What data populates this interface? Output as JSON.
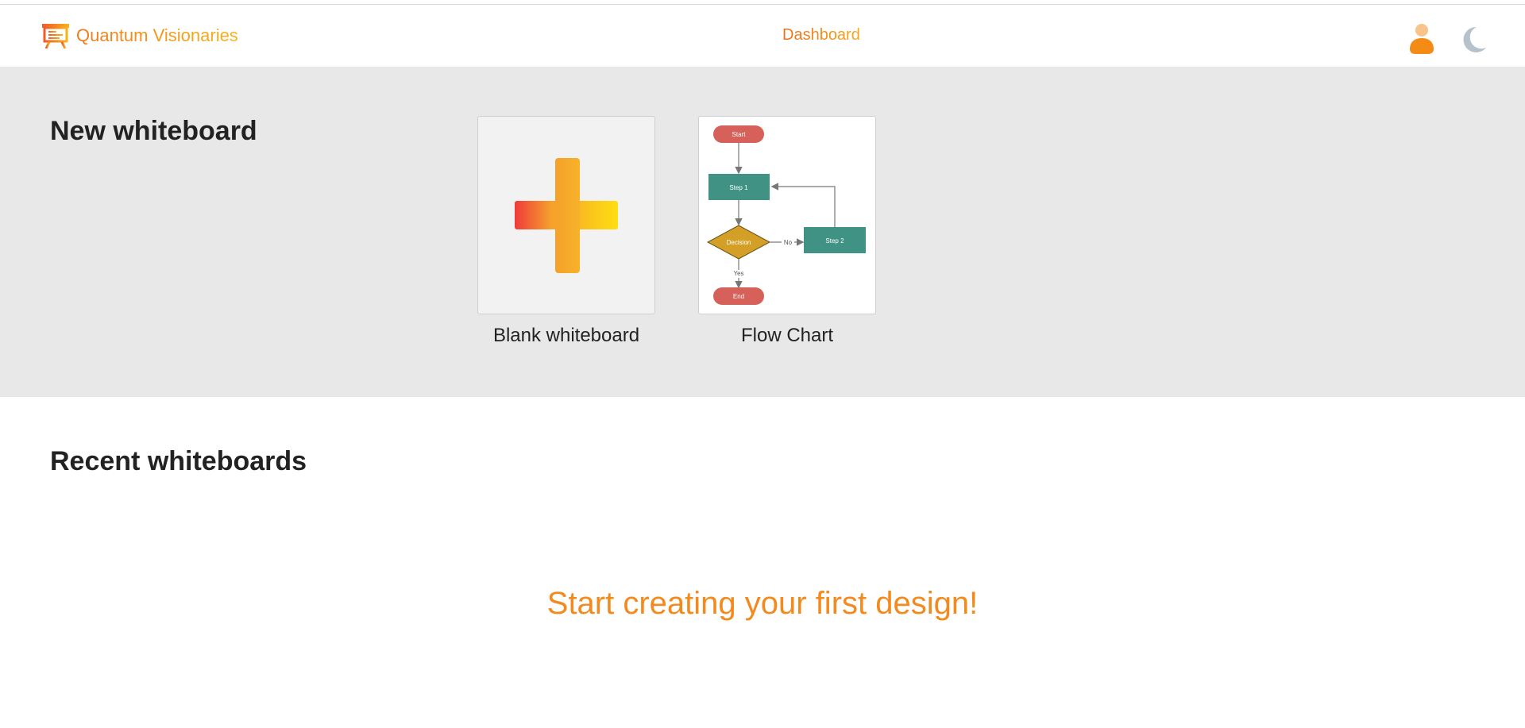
{
  "app": {
    "brand_name": "Quantum Visionaries",
    "brand_icon": "presentation-board-icon"
  },
  "nav": {
    "dashboard_label": "Dashboard"
  },
  "header_actions": {
    "user_icon": "user-icon",
    "theme_icon": "moon-icon"
  },
  "new_whiteboard": {
    "title": "New whiteboard",
    "templates": [
      {
        "label": "Blank whiteboard",
        "icon": "plus-icon"
      },
      {
        "label": "Flow Chart",
        "preview": {
          "start": "Start",
          "step1": "Step 1",
          "decision": "Decision",
          "no": "No",
          "step2": "Step 2",
          "yes": "Yes",
          "end": "End"
        }
      }
    ]
  },
  "recent": {
    "title": "Recent whiteboards",
    "empty_message": "Start creating your first design!"
  },
  "colors": {
    "accent_orange": "#f38a1e",
    "accent_yellow": "#f9c31a",
    "plus_red": "#ef3b3b",
    "flow_red": "#d6605a",
    "flow_teal": "#3f9284",
    "flow_gold": "#d49f27",
    "section_bg": "#e8e8e8"
  }
}
